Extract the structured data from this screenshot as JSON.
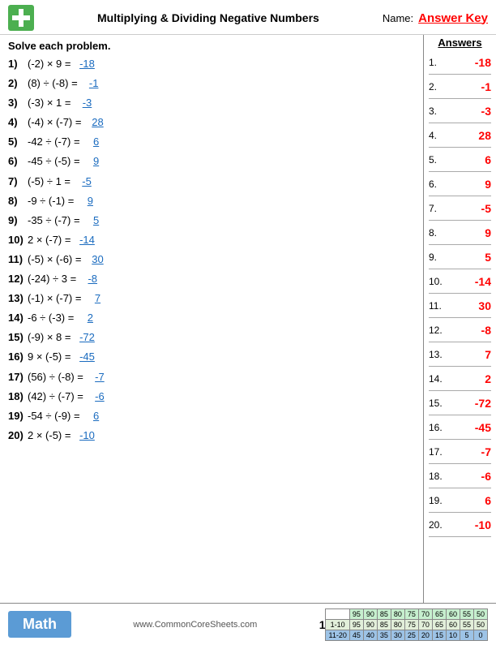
{
  "header": {
    "title": "Multiplying & Dividing Negative Numbers",
    "name_label": "Name:",
    "answer_key": "Answer Key"
  },
  "solve_heading": "Solve each problem.",
  "problems": [
    {
      "num": "1)",
      "text": "(-2) × 9 =",
      "answer": "-18"
    },
    {
      "num": "2)",
      "text": "(8) ÷ (-8) =",
      "answer": "-1"
    },
    {
      "num": "3)",
      "text": "(-3) × 1 =",
      "answer": "-3"
    },
    {
      "num": "4)",
      "text": "(-4) × (-7) =",
      "answer": "28"
    },
    {
      "num": "5)",
      "text": "-42 ÷ (-7) =",
      "answer": "6"
    },
    {
      "num": "6)",
      "text": "-45 ÷ (-5) =",
      "answer": "9"
    },
    {
      "num": "7)",
      "text": "(-5) ÷ 1 =",
      "answer": "-5"
    },
    {
      "num": "8)",
      "text": "-9 ÷ (-1) =",
      "answer": "9"
    },
    {
      "num": "9)",
      "text": "-35 ÷ (-7) =",
      "answer": "5"
    },
    {
      "num": "10)",
      "text": "2 × (-7) =",
      "answer": "-14"
    },
    {
      "num": "11)",
      "text": "(-5) × (-6) =",
      "answer": "30"
    },
    {
      "num": "12)",
      "text": "(-24) ÷ 3 =",
      "answer": "-8"
    },
    {
      "num": "13)",
      "text": "(-1) × (-7) =",
      "answer": "7"
    },
    {
      "num": "14)",
      "text": "-6 ÷ (-3) =",
      "answer": "2"
    },
    {
      "num": "15)",
      "text": "(-9) × 8 =",
      "answer": "-72"
    },
    {
      "num": "16)",
      "text": "9 × (-5) =",
      "answer": "-45"
    },
    {
      "num": "17)",
      "text": "(56) ÷ (-8) =",
      "answer": "-7"
    },
    {
      "num": "18)",
      "text": "(42) ÷ (-7) =",
      "answer": "-6"
    },
    {
      "num": "19)",
      "text": "-54 ÷ (-9) =",
      "answer": "6"
    },
    {
      "num": "20)",
      "text": "2 × (-5) =",
      "answer": "-10"
    }
  ],
  "answers_header": "Answers",
  "answers": [
    {
      "num": "1.",
      "val": "-18"
    },
    {
      "num": "2.",
      "val": "-1"
    },
    {
      "num": "3.",
      "val": "-3"
    },
    {
      "num": "4.",
      "val": "28"
    },
    {
      "num": "5.",
      "val": "6"
    },
    {
      "num": "6.",
      "val": "9"
    },
    {
      "num": "7.",
      "val": "-5"
    },
    {
      "num": "8.",
      "val": "9"
    },
    {
      "num": "9.",
      "val": "5"
    },
    {
      "num": "10.",
      "val": "-14"
    },
    {
      "num": "11.",
      "val": "30"
    },
    {
      "num": "12.",
      "val": "-8"
    },
    {
      "num": "13.",
      "val": "7"
    },
    {
      "num": "14.",
      "val": "2"
    },
    {
      "num": "15.",
      "val": "-72"
    },
    {
      "num": "16.",
      "val": "-45"
    },
    {
      "num": "17.",
      "val": "-7"
    },
    {
      "num": "18.",
      "val": "-6"
    },
    {
      "num": "19.",
      "val": "6"
    },
    {
      "num": "20.",
      "val": "-10"
    }
  ],
  "footer": {
    "math_label": "Math",
    "url": "www.CommonCoreSheets.com",
    "page": "1",
    "score_rows": [
      {
        "range": "1-10",
        "scores": [
          "95",
          "90",
          "85",
          "80",
          "75",
          "70",
          "65",
          "60",
          "55",
          "50"
        ]
      },
      {
        "range": "11-20",
        "scores": [
          "45",
          "40",
          "35",
          "30",
          "25",
          "20",
          "15",
          "10",
          "5",
          "0"
        ]
      }
    ],
    "score_headers": [
      "95",
      "90",
      "85",
      "80",
      "75",
      "70",
      "65",
      "60",
      "55",
      "50"
    ]
  }
}
